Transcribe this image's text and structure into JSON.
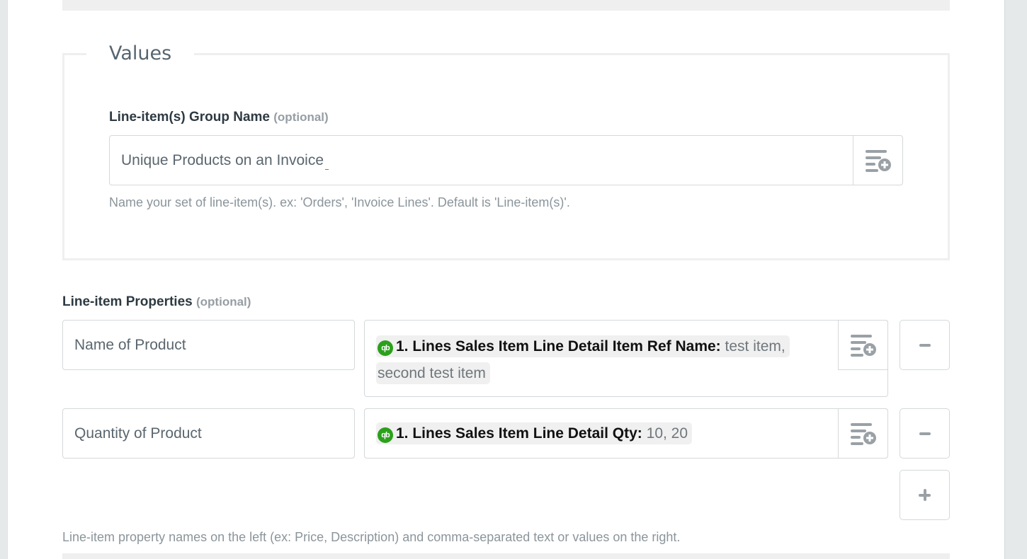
{
  "values_section": {
    "legend": "Values",
    "group_name": {
      "label": "Line-item(s) Group Name",
      "optional_tag": "(optional)",
      "value": "Unique Products on an Invoice",
      "insert_icon": "insert-data-icon",
      "help_text": "Name your set of line-item(s). ex: 'Orders', 'Invoice Lines'. Default is 'Line-item(s)'."
    }
  },
  "line_item_properties": {
    "label": "Line-item Properties",
    "optional_tag": "(optional)",
    "rows": [
      {
        "name": "Name of Product",
        "app_icon": "quickbooks-icon",
        "app_icon_text": "qb",
        "mapped_field": "1. Lines Sales Item Line Detail Item Ref Name:",
        "sample_value": "test item, second test item"
      },
      {
        "name": "Quantity of Product",
        "app_icon": "quickbooks-icon",
        "app_icon_text": "qb",
        "mapped_field": "1. Lines Sales Item Line Detail Qty:",
        "sample_value": "10, 20"
      }
    ],
    "remove_icon": "minus-icon",
    "add_icon": "plus-icon",
    "help_text": "Line-item property names on the left (ex: Price, Description) and comma-separated text or values on the right."
  },
  "colors": {
    "quickbooks_green": "#2ca01c",
    "page_background": "#e6e9ea",
    "accent_cursor": "#e0541a"
  }
}
